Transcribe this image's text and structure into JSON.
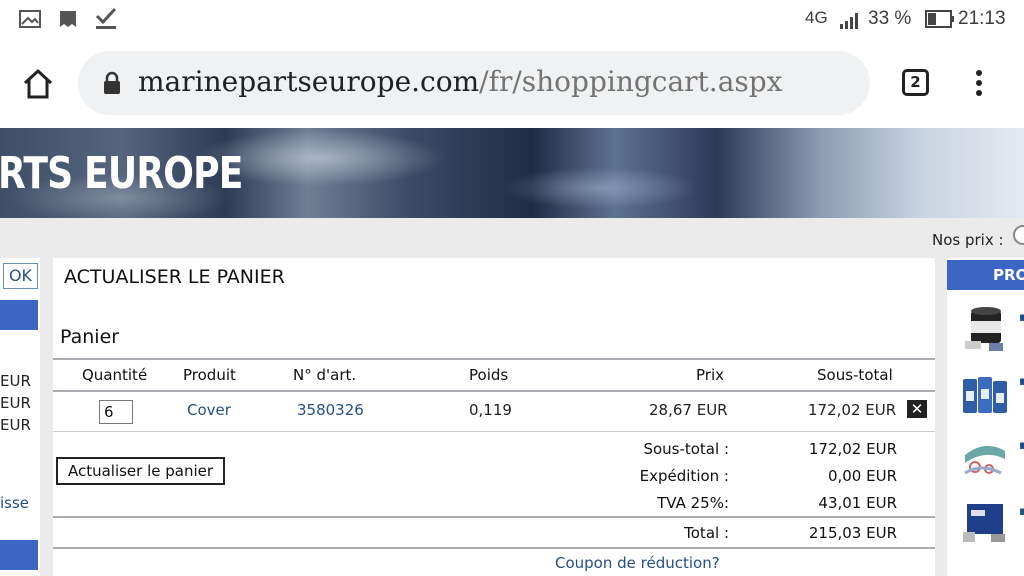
{
  "status_bar": {
    "network": "4G",
    "battery": "33 %",
    "time": "21:13"
  },
  "browser": {
    "url_domain": "marinepartseurope.com",
    "url_path": "/fr/shoppingcart.aspx",
    "tab_count": "2"
  },
  "banner": {
    "title": "RTS EUROPE"
  },
  "header_right": {
    "price_label": "Nos prix :"
  },
  "left_sidebar": {
    "ok_label": "OK",
    "eur_lines": [
      "EUR",
      "EUR",
      "EUR"
    ],
    "link_fragment": "isse"
  },
  "cart": {
    "heading": "ACTUALISER LE PANIER",
    "title": "Panier",
    "columns": [
      "Quantité",
      "Produit",
      "N° d'art.",
      "Poids",
      "Prix",
      "Sous-total"
    ],
    "items": [
      {
        "quantity": "6",
        "product": "Cover",
        "article_no": "3580326",
        "weight": "0,119",
        "price": "28,67 EUR",
        "subtotal": "172,02 EUR"
      }
    ],
    "remove_symbol": "✕",
    "update_button": "Actualiser le panier",
    "summary": {
      "subtotal_label": "Sous-total :",
      "subtotal_value": "172,02 EUR",
      "shipping_label": "Expédition :",
      "shipping_value": "0,00 EUR",
      "vat_label": "TVA 25%:",
      "vat_value": "43,01 EUR",
      "total_label": "Total :",
      "total_value": "215,03 EUR"
    },
    "coupon_link": "Coupon de réduction?"
  },
  "right_sidebar": {
    "header": "PRO"
  },
  "colors": {
    "accent_blue": "#3b66c4",
    "link_blue": "#244f86"
  }
}
